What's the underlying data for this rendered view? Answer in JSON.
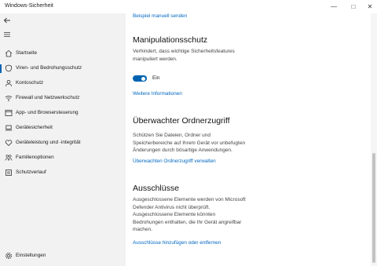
{
  "window": {
    "title": "Windows-Sicherheit",
    "minimize": "—",
    "maximize": "□",
    "close": "✕"
  },
  "sidebar": {
    "items": [
      {
        "label": "Startseite",
        "icon": "home-icon"
      },
      {
        "label": "Viren- und Bedrohungsschutz",
        "icon": "shield-icon",
        "selected": true
      },
      {
        "label": "Kontoschutz",
        "icon": "person-icon"
      },
      {
        "label": "Firewall und Netzwerkschutz",
        "icon": "wifi-icon"
      },
      {
        "label": "App- und Browsersteuerung",
        "icon": "app-window-icon"
      },
      {
        "label": "Gerätesicherheit",
        "icon": "laptop-icon"
      },
      {
        "label": "Geräteleistung und -integrität",
        "icon": "heart-icon"
      },
      {
        "label": "Familienoptionen",
        "icon": "family-icon"
      },
      {
        "label": "Schutzverlauf",
        "icon": "history-icon"
      }
    ],
    "settings_label": "Einstellungen"
  },
  "main": {
    "top_link": "Beispiel manuell senden",
    "tamper": {
      "title": "Manipulationsschutz",
      "desc": [
        "Verhindert, dass wichtige Sicherheitsfeatures",
        "manipuliert werden."
      ],
      "toggle_state": "Ein",
      "toggle_on": true,
      "link": "Weitere Informationen"
    },
    "cfa": {
      "title": "Überwachter Ordnerzugriff",
      "desc": [
        "Schützen Sie Dateien, Ordner und",
        "Speicherbereiche auf Ihrem Gerät vor unbefugten",
        "Änderungen durch bösartige Anwendungen."
      ],
      "link": "Überwachten Ordnerzugriff verwalten"
    },
    "exclusions": {
      "title": "Ausschlüsse",
      "desc": [
        "Ausgeschlossene Elemente werden von Microsoft",
        "Defender Antivirus nicht überprüft.",
        "Ausgeschlossene Elemente könnten",
        "Bedrohungen enthalten, die Ihr Gerät angreifbar",
        "machen."
      ],
      "link": "Ausschlüsse hinzufügen oder entfernen"
    }
  },
  "colors": {
    "accent": "#0063b1",
    "link": "#0067c0",
    "sidebar_bg": "#f2f2f2"
  }
}
